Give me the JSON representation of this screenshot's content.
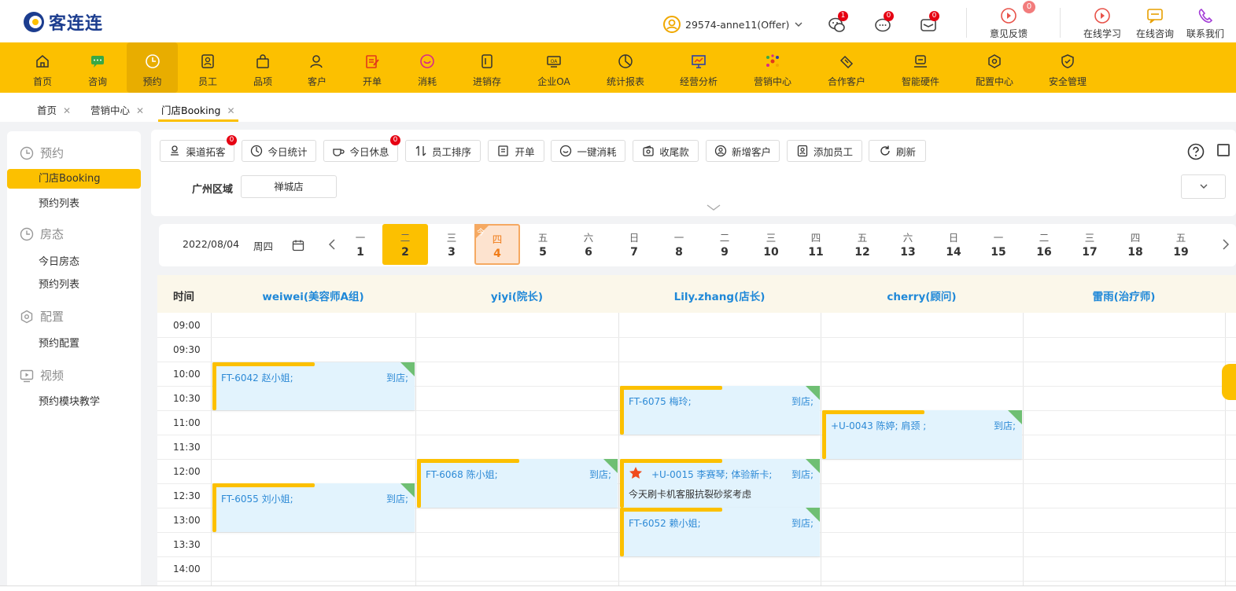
{
  "brand": {
    "name": "客连连"
  },
  "header": {
    "user": "29574-anne11(Offer)",
    "badges": {
      "wechat": "1",
      "consult": "0",
      "message": "0",
      "feedback": "0"
    },
    "tools": [
      "意见反馈",
      "在线学习",
      "在线咨询",
      "联系我们"
    ]
  },
  "nav": [
    "首页",
    "咨询",
    "预约",
    "员工",
    "品项",
    "客户",
    "开单",
    "消耗",
    "进销存",
    "企业OA",
    "统计报表",
    "经营分析",
    "营销中心",
    "合作客户",
    "智能硬件",
    "配置中心",
    "安全管理"
  ],
  "tabs": [
    "首页",
    "营销中心",
    "门店Booking"
  ],
  "sidebar": {
    "groups": [
      {
        "title": "预约",
        "items": [
          "门店Booking",
          "预约列表"
        ]
      },
      {
        "title": "房态",
        "items": [
          "今日房态",
          "预约列表"
        ]
      },
      {
        "title": "配置",
        "items": [
          "预约配置"
        ]
      },
      {
        "title": "视频",
        "items": [
          "预约模块教学"
        ]
      }
    ]
  },
  "toolbar": {
    "buttons": [
      "渠道拓客",
      "今日统计",
      "今日休息",
      "员工排序",
      "开单",
      "一键消耗",
      "收尾款",
      "新增客户",
      "添加员工",
      "刷新"
    ],
    "badge_channel": "0",
    "badge_rest": "0",
    "region_label": "广州区域",
    "store": "禅城店"
  },
  "datebar": {
    "date": "2022/08/04",
    "weekday": "周四",
    "today_mark": "今",
    "days": [
      {
        "w": "一",
        "n": "1"
      },
      {
        "w": "二",
        "n": "2"
      },
      {
        "w": "三",
        "n": "3"
      },
      {
        "w": "四",
        "n": "4"
      },
      {
        "w": "五",
        "n": "5"
      },
      {
        "w": "六",
        "n": "6"
      },
      {
        "w": "日",
        "n": "7"
      },
      {
        "w": "一",
        "n": "8"
      },
      {
        "w": "二",
        "n": "9"
      },
      {
        "w": "三",
        "n": "10"
      },
      {
        "w": "四",
        "n": "11"
      },
      {
        "w": "五",
        "n": "12"
      },
      {
        "w": "六",
        "n": "13"
      },
      {
        "w": "日",
        "n": "14"
      },
      {
        "w": "一",
        "n": "15"
      },
      {
        "w": "二",
        "n": "16"
      },
      {
        "w": "三",
        "n": "17"
      },
      {
        "w": "四",
        "n": "18"
      },
      {
        "w": "五",
        "n": "19"
      }
    ]
  },
  "schedule": {
    "time_header": "时间",
    "staff": [
      "weiwei(美容师A组)",
      "yiyi(院长)",
      "Lily.zhang(店长)",
      "cherry(顾问)",
      "雷雨(治疗师)"
    ],
    "times": [
      "09:00",
      "09:30",
      "10:00",
      "10:30",
      "11:00",
      "11:30",
      "12:00",
      "12:30",
      "13:00",
      "13:30",
      "14:00"
    ],
    "appointments": [
      {
        "code": "FT-6042 赵小姐;",
        "status": "到店;"
      },
      {
        "code": "FT-6055 刘小姐;",
        "status": "到店;"
      },
      {
        "code": "FT-6068 陈小姐;",
        "status": "到店;"
      },
      {
        "code": "FT-6075 梅玲;",
        "status": "到店;"
      },
      {
        "code": "+U-0015 李赛琴;   体验新卡;",
        "status": "到店;",
        "note": "今天刷卡机客服抗裂砂浆考虑"
      },
      {
        "code": "FT-6052 赖小姐;",
        "status": "到店;"
      },
      {
        "code": "+U-0043 陈婷;   肩颈 ;",
        "status": "到店;"
      }
    ]
  }
}
